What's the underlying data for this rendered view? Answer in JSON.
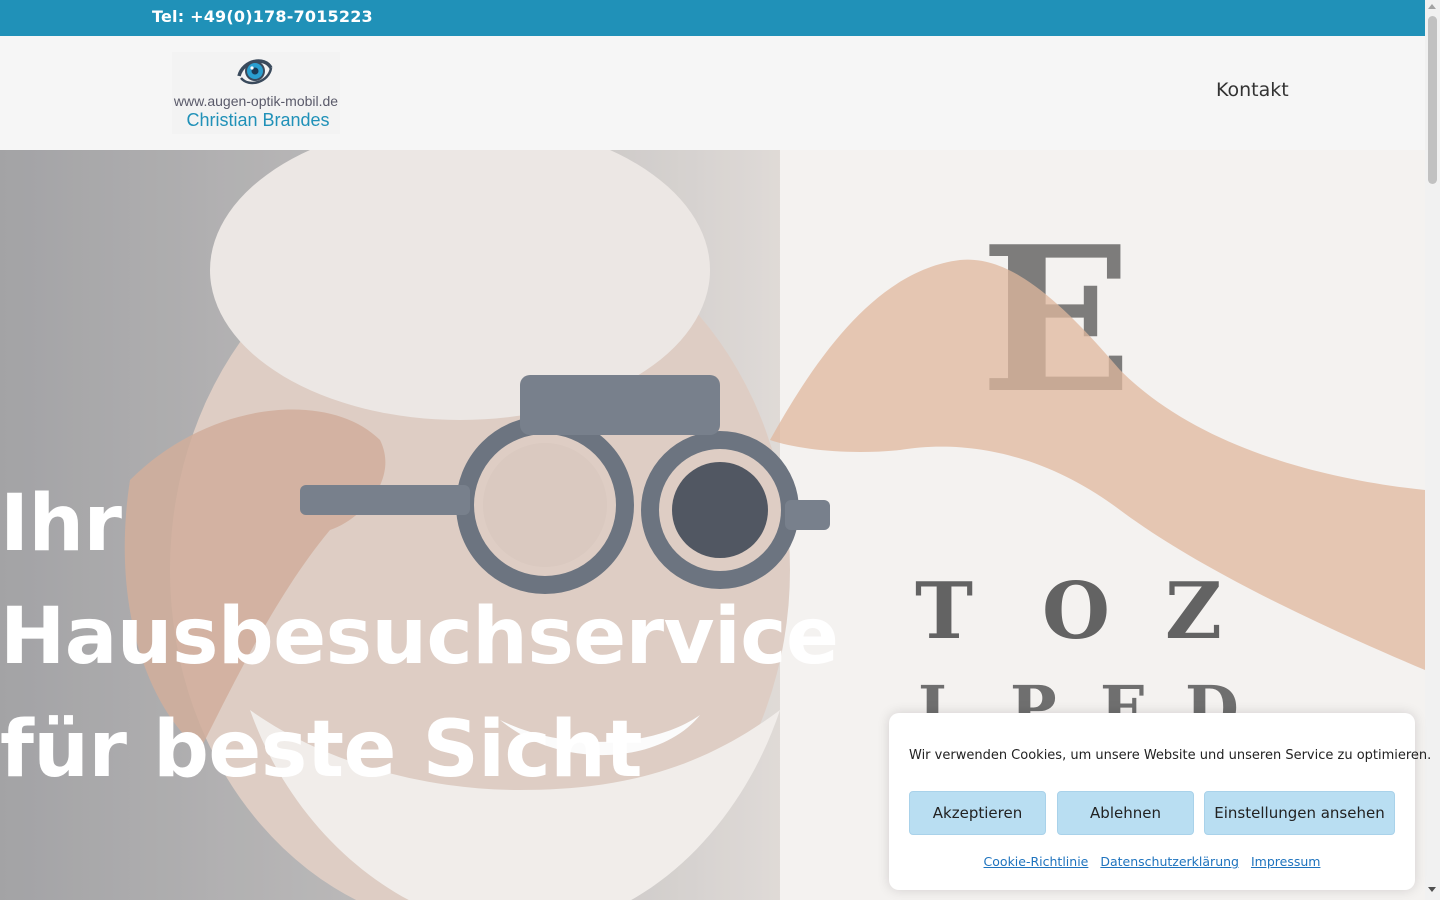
{
  "topbar": {
    "phone": "Tel: +49(0)178-7015223"
  },
  "header": {
    "logo": {
      "url_text": "www.augen-optik-mobil.de",
      "owner_text": "Christian Brandes"
    },
    "nav": {
      "contact": "Kontakt"
    }
  },
  "hero": {
    "title_line1": "Ihr",
    "title_line2": "Hausbesuchservice",
    "title_line3": "für beste Sicht",
    "eye_chart_letters": [
      "E",
      "T",
      "O",
      "Z",
      "L",
      "P",
      "E",
      "D"
    ]
  },
  "cookie": {
    "message": "Wir verwenden Cookies, um unsere Website und unseren Service zu optimieren.",
    "accept": "Akzeptieren",
    "deny": "Ablehnen",
    "settings": "Einstellungen ansehen",
    "links": {
      "cookie_policy": "Cookie-Richtlinie",
      "privacy": "Datenschutzerklärung",
      "imprint": "Impressum"
    }
  },
  "colors": {
    "brand": "#2091b8",
    "button_bg": "#b9def2",
    "link": "#1e73be"
  }
}
